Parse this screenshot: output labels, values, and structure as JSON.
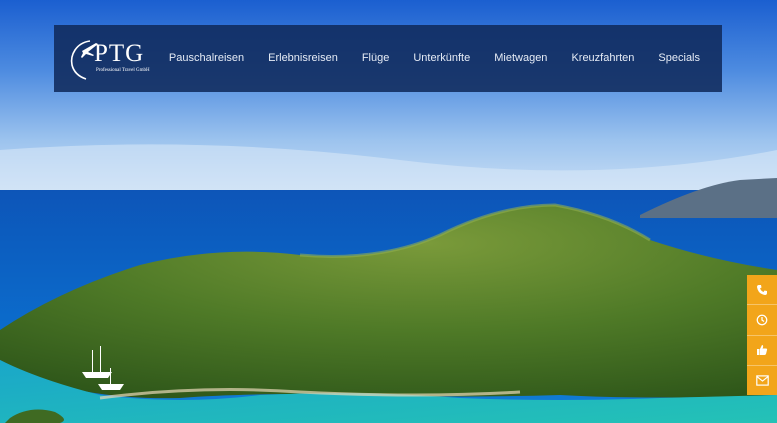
{
  "brand": {
    "logo_text": "PTG",
    "logo_subtext": "Professional Travel GmbH"
  },
  "nav": {
    "items": [
      {
        "label": "Pauschalreisen"
      },
      {
        "label": "Erlebnisreisen"
      },
      {
        "label": "Flüge"
      },
      {
        "label": "Unterkünfte"
      },
      {
        "label": "Mietwagen"
      },
      {
        "label": "Kreuzfahrten"
      },
      {
        "label": "Specials"
      }
    ]
  },
  "sidebar": {
    "buttons": [
      {
        "icon": "phone-icon"
      },
      {
        "icon": "clock-icon"
      },
      {
        "icon": "thumbs-up-icon"
      },
      {
        "icon": "mail-icon"
      }
    ]
  },
  "colors": {
    "navbar_bg": "#102a5c",
    "accent": "#f2a51a",
    "nav_text": "#e6ecf6"
  }
}
